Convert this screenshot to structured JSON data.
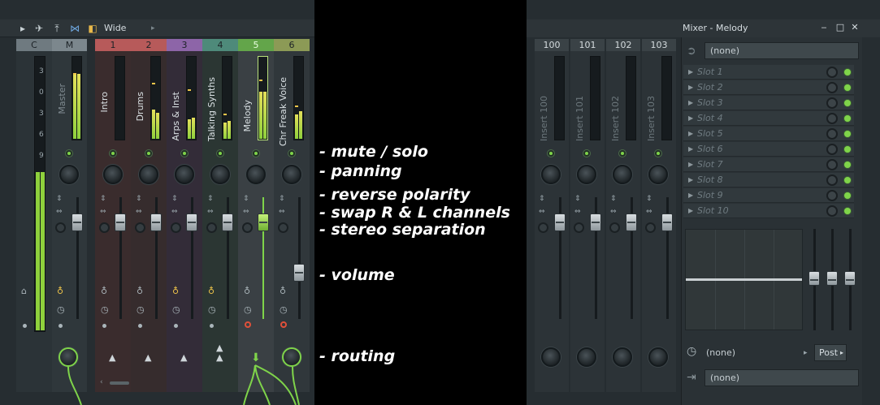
{
  "toolbar": {
    "preset": "Wide"
  },
  "left_channels": [
    {
      "header": "C",
      "label": ""
    },
    {
      "header": "M",
      "label": "Master"
    },
    {
      "header": "1",
      "label": "Intro"
    },
    {
      "header": "2",
      "label": "Drums"
    },
    {
      "header": "3",
      "label": "Arps & Inst"
    },
    {
      "header": "4",
      "label": "Talking Synths"
    },
    {
      "header": "5",
      "label": "Melody"
    },
    {
      "header": "6",
      "label": "Chr Freak Voice"
    }
  ],
  "meter_scale": [
    "3",
    "0",
    "3",
    "6",
    "9"
  ],
  "right_channels": [
    {
      "header": "100",
      "label": "Insert 100"
    },
    {
      "header": "101",
      "label": "Insert 101"
    },
    {
      "header": "102",
      "label": "Insert 102"
    },
    {
      "header": "103",
      "label": "Insert 103"
    }
  ],
  "window": {
    "title": "Mixer - Melody"
  },
  "fx": {
    "input": "(none)",
    "slots": [
      "Slot 1",
      "Slot 2",
      "Slot 3",
      "Slot 4",
      "Slot 5",
      "Slot 6",
      "Slot 7",
      "Slot 8",
      "Slot 9",
      "Slot 10"
    ],
    "sidechain": "(none)",
    "post_label": "Post",
    "output": "(none)"
  },
  "annotations": {
    "mute_solo": "- mute / solo",
    "panning": "- panning",
    "reverse_polarity": "- reverse polarity",
    "swap_channels": "- swap R & L channels",
    "stereo_separation": "- stereo separation",
    "volume": "- volume",
    "routing": "- routing"
  },
  "colors": {
    "accent_green": "#7fd44a",
    "header_red": "#b75a5a",
    "header_purple": "#8d65a8",
    "header_teal": "#4e8a7a",
    "header_green": "#63a54a"
  }
}
